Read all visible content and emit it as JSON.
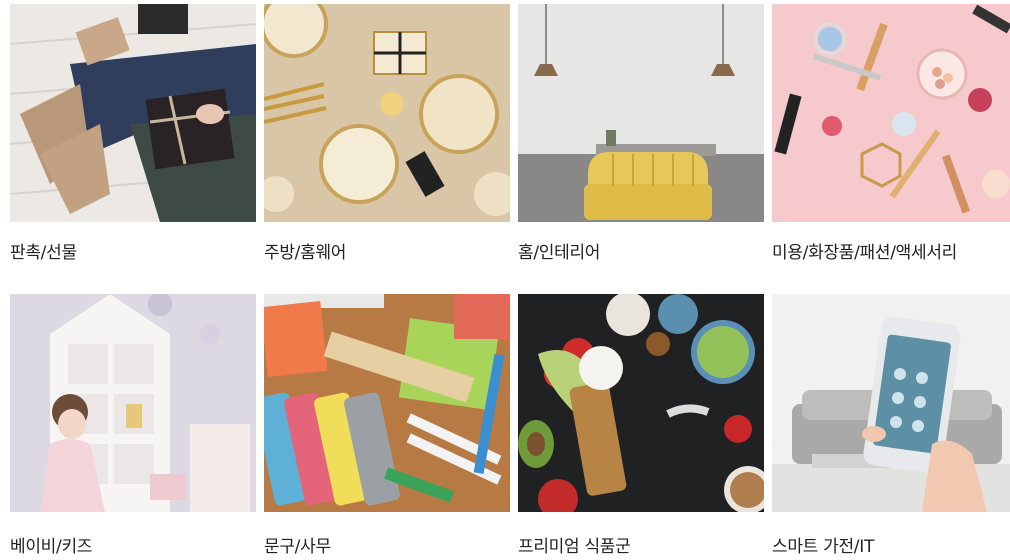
{
  "categories": [
    {
      "label": "판촉/선물",
      "image": "gift-box-photo"
    },
    {
      "label": "주방/홈웨어",
      "image": "party-tableware-photo"
    },
    {
      "label": "홈/인테리어",
      "image": "yellow-armchair-photo"
    },
    {
      "label": "미용/화장품/패션/액세서리",
      "image": "cosmetics-photo"
    },
    {
      "label": "베이비/키즈",
      "image": "dollhouse-child-photo"
    },
    {
      "label": "문구/사무",
      "image": "stationery-photo"
    },
    {
      "label": "프리미엄 식품군",
      "image": "premium-food-photo"
    },
    {
      "label": "스마트 가전/IT",
      "image": "smartphone-home-photo"
    }
  ]
}
